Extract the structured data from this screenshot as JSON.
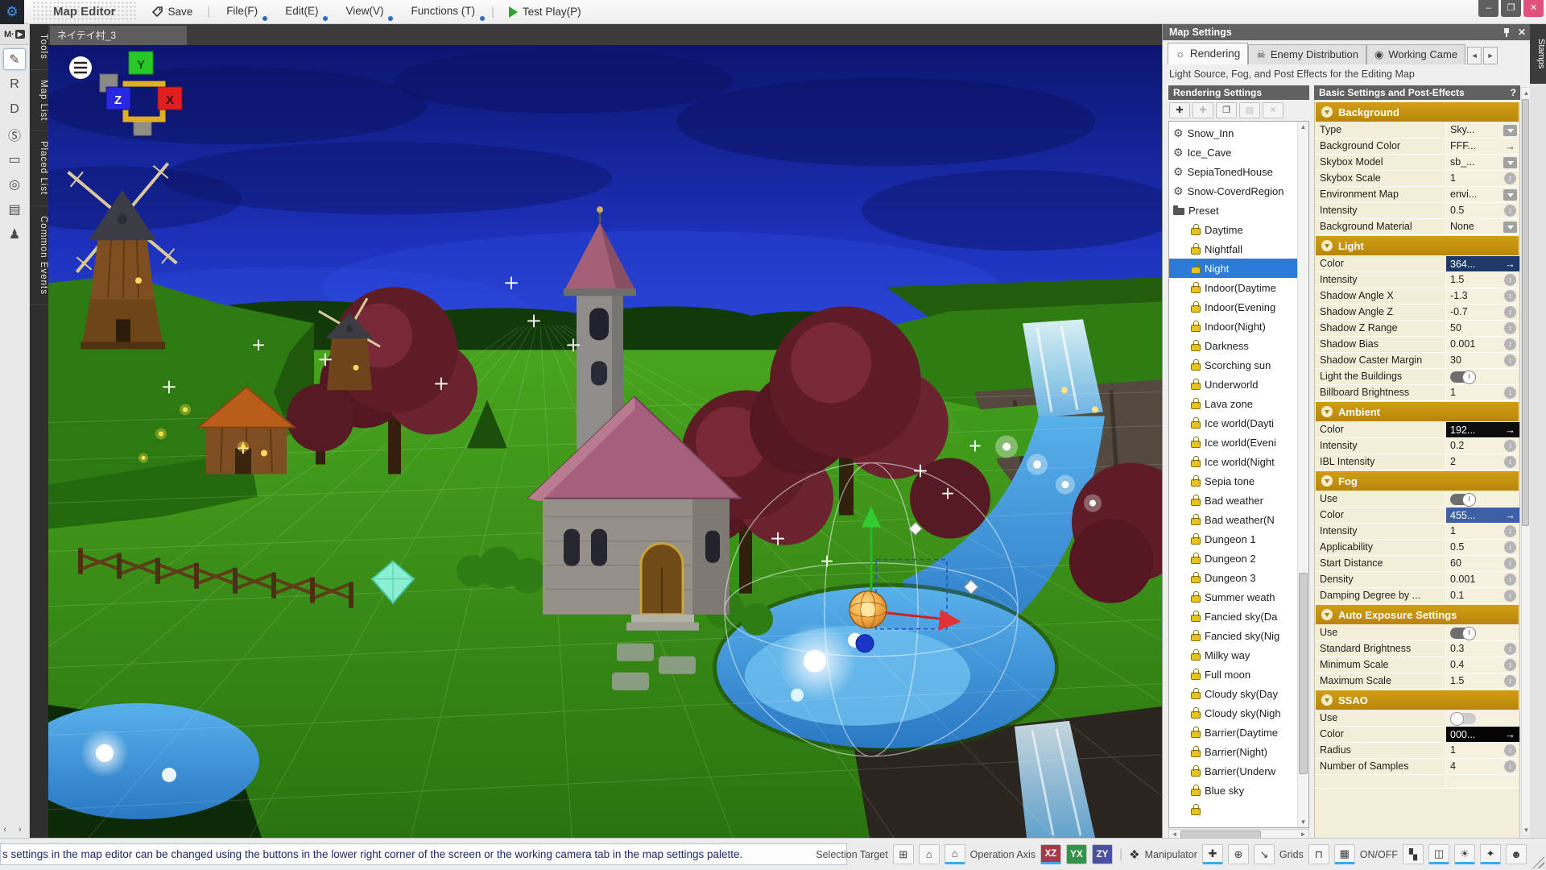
{
  "menubar": {
    "title": "Map Editor",
    "save": "Save",
    "menus": [
      "File(F)",
      "Edit(E)",
      "View(V)",
      "Functions (T)"
    ],
    "test_play": "Test Play(P)"
  },
  "window_controls": {
    "minimize": "–",
    "maximize": "❐",
    "close": "✕"
  },
  "left_toolbar": {
    "top_button": "M·",
    "icons": [
      {
        "name": "map-edit-tool-icon",
        "glyph": "✎",
        "active": true
      },
      {
        "name": "resources-tool-icon",
        "glyph": "R",
        "active": false
      },
      {
        "name": "database-tool-icon",
        "glyph": "D",
        "active": false
      },
      {
        "name": "system-tool-icon",
        "glyph": "Ⓢ",
        "active": false
      },
      {
        "name": "display-tool-icon",
        "glyph": "▭",
        "active": false
      },
      {
        "name": "camera-tool-icon",
        "glyph": "◎",
        "active": false
      },
      {
        "name": "stamp-tool-icon",
        "glyph": "▤",
        "active": false
      },
      {
        "name": "event-tool-icon",
        "glyph": "♟",
        "active": false
      }
    ],
    "pager": "‹ ›"
  },
  "left_tabs": [
    "Tools",
    "Map List",
    "Placed List",
    "Common Events"
  ],
  "viewport": {
    "tab": "ネイテイ村_3",
    "gizmo": {
      "x": "X",
      "y": "Y",
      "z": "Z"
    }
  },
  "map_settings": {
    "title": "Map Settings",
    "tabs": [
      {
        "label": "Rendering",
        "icon": "☼",
        "icon_name": "lamp-icon",
        "active": true
      },
      {
        "label": "Enemy Distribution",
        "icon": "☠",
        "icon_name": "enemy-icon",
        "active": false
      },
      {
        "label": "Working Came",
        "icon": "◉",
        "icon_name": "camera-icon",
        "active": false
      }
    ],
    "tab_scroll_left": "◄",
    "tab_scroll_right": "►",
    "description": "Light Source, Fog, and Post Effects for the Editing Map",
    "rendering_settings": {
      "header": "Rendering Settings",
      "toolbar": [
        {
          "name": "add-button",
          "glyph": "✚",
          "enabled": true
        },
        {
          "name": "add-child-button",
          "glyph": "✚",
          "enabled": false
        },
        {
          "name": "duplicate-button",
          "glyph": "❐",
          "enabled": true
        },
        {
          "name": "paste-button",
          "glyph": "▤",
          "enabled": false
        },
        {
          "name": "delete-button",
          "glyph": "✕",
          "enabled": false
        }
      ],
      "items": [
        {
          "icon": "gear",
          "label": "Snow_Inn"
        },
        {
          "icon": "gear",
          "label": "Ice_Cave"
        },
        {
          "icon": "gear",
          "label": "SepiaTonedHouse"
        },
        {
          "icon": "gear",
          "label": "Snow-CoverdRegion"
        },
        {
          "icon": "folder",
          "label": "Preset"
        },
        {
          "icon": "lock",
          "label": "Daytime",
          "indent": true
        },
        {
          "icon": "lock",
          "label": "Nightfall",
          "indent": true
        },
        {
          "icon": "lock",
          "label": "Night",
          "indent": true,
          "selected": true
        },
        {
          "icon": "lock",
          "label": "Indoor(Daytime",
          "indent": true
        },
        {
          "icon": "lock",
          "label": "Indoor(Evening",
          "indent": true
        },
        {
          "icon": "lock",
          "label": "Indoor(Night)",
          "indent": true
        },
        {
          "icon": "lock",
          "label": "Darkness",
          "indent": true
        },
        {
          "icon": "lock",
          "label": "Scorching sun",
          "indent": true
        },
        {
          "icon": "lock",
          "label": "Underworld",
          "indent": true
        },
        {
          "icon": "lock",
          "label": "Lava zone",
          "indent": true
        },
        {
          "icon": "lock",
          "label": "Ice world(Dayti",
          "indent": true
        },
        {
          "icon": "lock",
          "label": "Ice world(Eveni",
          "indent": true
        },
        {
          "icon": "lock",
          "label": "Ice world(Night",
          "indent": true
        },
        {
          "icon": "lock",
          "label": "Sepia tone",
          "indent": true
        },
        {
          "icon": "lock",
          "label": "Bad weather",
          "indent": true
        },
        {
          "icon": "lock",
          "label": "Bad weather(N",
          "indent": true
        },
        {
          "icon": "lock",
          "label": "Dungeon 1",
          "indent": true
        },
        {
          "icon": "lock",
          "label": "Dungeon 2",
          "indent": true
        },
        {
          "icon": "lock",
          "label": "Dungeon 3",
          "indent": true
        },
        {
          "icon": "lock",
          "label": "Summer weath",
          "indent": true
        },
        {
          "icon": "lock",
          "label": "Fancied sky(Da",
          "indent": true
        },
        {
          "icon": "lock",
          "label": "Fancied sky(Nig",
          "indent": true
        },
        {
          "icon": "lock",
          "label": "Milky way",
          "indent": true
        },
        {
          "icon": "lock",
          "label": "Full moon",
          "indent": true
        },
        {
          "icon": "lock",
          "label": "Cloudy sky(Day",
          "indent": true
        },
        {
          "icon": "lock",
          "label": "Cloudy sky(Nigh",
          "indent": true
        },
        {
          "icon": "lock",
          "label": "Barrier(Daytime",
          "indent": true
        },
        {
          "icon": "lock",
          "label": "Barrier(Night)",
          "indent": true
        },
        {
          "icon": "lock",
          "label": "Barrier(Underw",
          "indent": true
        },
        {
          "icon": "lock",
          "label": "Blue sky",
          "indent": true
        },
        {
          "icon": "lock",
          "label": "",
          "indent": true
        }
      ]
    },
    "properties": {
      "header": "Basic Settings and Post-Effects",
      "help": "?",
      "groups": [
        {
          "title": "Background",
          "rows": [
            {
              "label": "Type",
              "value": "Sky...",
              "control": "dropdown"
            },
            {
              "label": "Background Color",
              "value": "FFF...",
              "control": "arrow"
            },
            {
              "label": "Skybox Model",
              "value": "sb_...",
              "control": "dropdown"
            },
            {
              "label": "Skybox Scale",
              "value": "1",
              "control": "stepper"
            },
            {
              "label": "Environment Map",
              "value": "envi...",
              "control": "dropdown"
            },
            {
              "label": "Intensity",
              "value": "0.5",
              "control": "stepper"
            },
            {
              "label": "Background Material",
              "value": "None",
              "control": "dropdown"
            }
          ]
        },
        {
          "title": "Light",
          "rows": [
            {
              "label": "Color",
              "value": "364...",
              "control": "arrow",
              "value_bg": "#1d3a66",
              "value_fg": "#ffffff"
            },
            {
              "label": "Intensity",
              "value": "1.5",
              "control": "stepper"
            },
            {
              "label": "Shadow Angle X",
              "value": "-1.3",
              "control": "stepper"
            },
            {
              "label": "Shadow Angle Z",
              "value": "-0.7",
              "control": "stepper"
            },
            {
              "label": "Shadow Z Range",
              "value": "50",
              "control": "stepper"
            },
            {
              "label": "Shadow Bias",
              "value": "0.001",
              "control": "stepper"
            },
            {
              "label": "Shadow Caster Margin",
              "value": "30",
              "control": "stepper"
            },
            {
              "label": "Light the Buildings",
              "value": "",
              "control": "toggle-on"
            },
            {
              "label": "Billboard Brightness",
              "value": "1",
              "control": "stepper"
            }
          ]
        },
        {
          "title": "Ambient",
          "rows": [
            {
              "label": "Color",
              "value": "192...",
              "control": "arrow",
              "value_bg": "#0c0c0c",
              "value_fg": "#ffffff"
            },
            {
              "label": "Intensity",
              "value": "0.2",
              "control": "stepper"
            },
            {
              "label": "IBL Intensity",
              "value": "2",
              "control": "stepper"
            }
          ]
        },
        {
          "title": "Fog",
          "rows": [
            {
              "label": "Use",
              "value": "",
              "control": "toggle-on"
            },
            {
              "label": "Color",
              "value": "455...",
              "control": "arrow",
              "value_bg": "#3e5fa5",
              "value_fg": "#ffffff"
            },
            {
              "label": "Intensity",
              "value": "1",
              "control": "stepper"
            },
            {
              "label": "Applicability",
              "value": "0.5",
              "control": "stepper"
            },
            {
              "label": "Start Distance",
              "value": "60",
              "control": "stepper"
            },
            {
              "label": "Density",
              "value": "0.001",
              "control": "stepper"
            },
            {
              "label": "Damping Degree by ...",
              "value": "0.1",
              "control": "stepper"
            }
          ]
        },
        {
          "title": "Auto Exposure Settings",
          "rows": [
            {
              "label": "Use",
              "value": "",
              "control": "toggle-on"
            },
            {
              "label": "Standard Brightness",
              "value": "0.3",
              "control": "stepper"
            },
            {
              "label": "Minimum Scale",
              "value": "0.4",
              "control": "stepper"
            },
            {
              "label": "Maximum Scale",
              "value": "1.5",
              "control": "stepper"
            }
          ]
        },
        {
          "title": "SSAO",
          "rows": [
            {
              "label": "Use",
              "value": "",
              "control": "toggle-off"
            },
            {
              "label": "Color",
              "value": "000...",
              "control": "arrow",
              "value_bg": "#050505",
              "value_fg": "#ffffff"
            },
            {
              "label": "Radius",
              "value": "1",
              "control": "stepper"
            },
            {
              "label": "Number of Samples",
              "value": "4",
              "control": "stepper"
            },
            {
              "label": "",
              "value": "",
              "control": "none",
              "partial": true
            }
          ]
        }
      ]
    }
  },
  "stamps_tab": "Stamps",
  "statusbar": {
    "message": "s settings in the map editor can be changed using the buttons in the lower right corner of the screen or the working camera tab in the map settings palette.",
    "groups": [
      {
        "label": "Selection Target",
        "buttons": [
          {
            "name": "selection-grid-button",
            "glyph": "⊞",
            "active": false
          },
          {
            "name": "selection-object-button",
            "glyph": "⌂",
            "active": false
          },
          {
            "name": "selection-building-button",
            "glyph": "⌂",
            "active": true
          }
        ]
      },
      {
        "label": "Operation Axis",
        "buttons": [
          {
            "name": "axis-xz-button",
            "text": "XZ",
            "bg": "#a23a4a",
            "active": true
          },
          {
            "name": "axis-yx-button",
            "text": "YX",
            "bg": "#35924a",
            "active": false
          },
          {
            "name": "axis-zy-button",
            "text": "ZY",
            "bg": "#4c50a0",
            "active": false
          }
        ]
      },
      {
        "sep": true
      },
      {
        "icon": "❖",
        "icon_name": "manipulator-icon",
        "label": "Manipulator",
        "buttons": [
          {
            "name": "manipulator-move-button",
            "glyph": "✚",
            "active": true
          },
          {
            "name": "manipulator-rotate-button",
            "glyph": "⊕",
            "active": false
          },
          {
            "name": "manipulator-scale-button",
            "glyph": "↘",
            "active": false
          }
        ]
      },
      {
        "label": "Grids",
        "buttons": [
          {
            "name": "grid-snap-button",
            "glyph": "⊓",
            "active": false
          },
          {
            "name": "grid-show-button",
            "glyph": "▦",
            "active": true
          }
        ]
      },
      {
        "label": "ON/OFF",
        "buttons": [
          {
            "name": "toggle-tiles-button",
            "glyph": "▚",
            "active": false
          },
          {
            "name": "toggle-box-button",
            "glyph": "◫",
            "active": true
          },
          {
            "name": "toggle-light-button",
            "glyph": "☀",
            "active": true
          },
          {
            "name": "toggle-effects-button",
            "glyph": "✦",
            "active": true
          },
          {
            "name": "toggle-enemy-button",
            "glyph": "☻",
            "active": false
          }
        ]
      }
    ]
  },
  "colors": {
    "accent_selection": "#2a7cd8",
    "group_header": "#c8940f",
    "active_underline": "#3fa8e8",
    "lock": "#e8c51e",
    "close_button": "#e0517d"
  }
}
